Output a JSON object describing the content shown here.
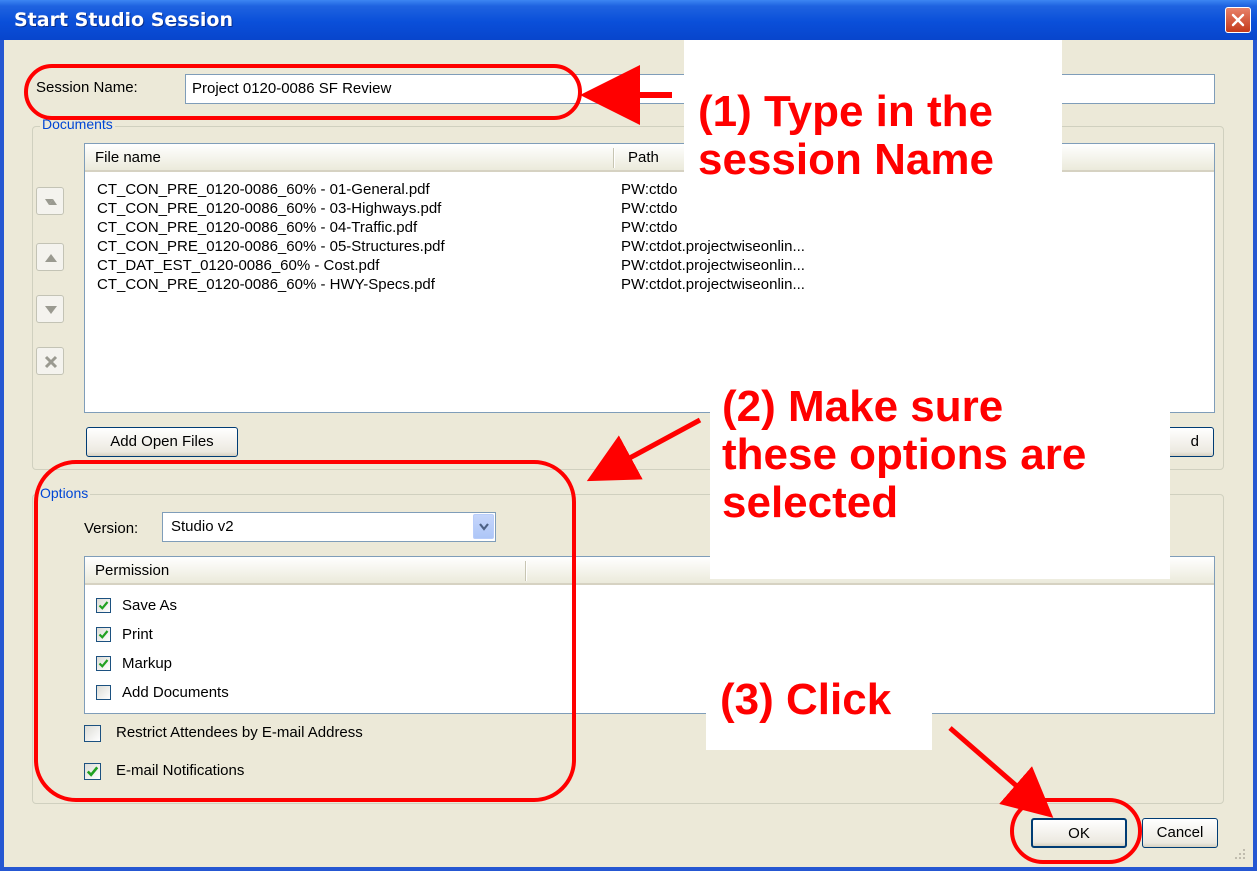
{
  "window": {
    "title": "Start Studio Session"
  },
  "session": {
    "label": "Session Name:",
    "value": "Project 0120-0086 SF Review"
  },
  "documents": {
    "group_title": "Documents",
    "columns": [
      "File name",
      "Path"
    ],
    "rows": [
      {
        "name": "CT_CON_PRE_0120-0086_60% - 01-General.pdf",
        "path": "PW:ctdo"
      },
      {
        "name": "CT_CON_PRE_0120-0086_60% - 03-Highways.pdf",
        "path": "PW:ctdo"
      },
      {
        "name": "CT_CON_PRE_0120-0086_60% - 04-Traffic.pdf",
        "path": "PW:ctdo"
      },
      {
        "name": "CT_CON_PRE_0120-0086_60% - 05-Structures.pdf",
        "path": "PW:ctdot.projectwiseonlin..."
      },
      {
        "name": "CT_DAT_EST_0120-0086_60% - Cost.pdf",
        "path": "PW:ctdot.projectwiseonlin..."
      },
      {
        "name": "CT_CON_PRE_0120-0086_60% - HWY-Specs.pdf",
        "path": "PW:ctdot.projectwiseonlin..."
      }
    ],
    "add_open_files_label": "Add Open Files",
    "right_button_fragment": "d"
  },
  "options": {
    "group_title": "Options",
    "version_label": "Version:",
    "version_value": "Studio v2",
    "permission_header": "Permission",
    "permissions": [
      {
        "label": "Save As",
        "checked": true
      },
      {
        "label": "Print",
        "checked": true
      },
      {
        "label": "Markup",
        "checked": true
      },
      {
        "label": "Add Documents",
        "checked": false
      }
    ],
    "restrict_label": "Restrict Attendees by E-mail Address",
    "restrict_checked": false,
    "email_label": "E-mail Notifications",
    "email_checked": true
  },
  "buttons": {
    "ok": "OK",
    "cancel": "Cancel"
  },
  "callouts": {
    "step1_line1": "(1) Type in the",
    "step1_line2": "session Name",
    "step2_line1": "(2) Make sure",
    "step2_line2": "these options are",
    "step2_line3": "selected",
    "step3": "(3) Click"
  },
  "colors": {
    "annotation": "#ff0000",
    "title_bar": "#0a4fd9",
    "dialog_face": "#ece9d8",
    "group_title": "#0046d5"
  }
}
